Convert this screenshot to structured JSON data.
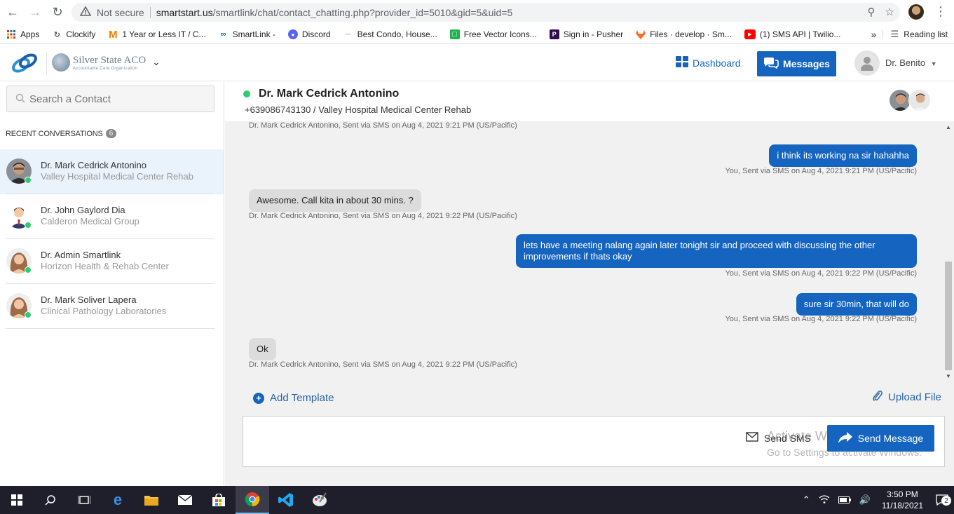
{
  "browser": {
    "security_label": "Not secure",
    "url_host": "smartstart.us",
    "url_path": "/smartlink/chat/contact_chatting.php?provider_id=5010&gid=5&uid=5",
    "bookmarks": [
      {
        "label": "Apps",
        "icon": "apps-grid-icon"
      },
      {
        "label": "Clockify",
        "icon": "clockify-icon"
      },
      {
        "label": "1 Year or Less IT / C...",
        "icon": "m-logo-icon"
      },
      {
        "label": "SmartLink -",
        "icon": "smartlink-icon"
      },
      {
        "label": "Discord",
        "icon": "discord-icon"
      },
      {
        "label": "Best Condo, House...",
        "icon": "site-icon"
      },
      {
        "label": "Free Vector Icons...",
        "icon": "flaticon-icon"
      },
      {
        "label": "Sign in - Pusher",
        "icon": "pusher-icon"
      },
      {
        "label": "Files · develop · Sm...",
        "icon": "gitlab-icon"
      },
      {
        "label": "(1) SMS API | Twilio...",
        "icon": "youtube-icon"
      }
    ],
    "bookmarks_more": "»",
    "reading_list": "Reading list"
  },
  "header": {
    "org_name": "Silver State ACO",
    "org_sub": "Accountable Care Organization",
    "dashboard_label": "Dashboard",
    "messages_label": "Messages",
    "user_name": "Dr. Benito"
  },
  "sidebar": {
    "search_placeholder": "Search a Contact",
    "recent_title": "RECENT CONVERSATIONS",
    "recent_count": "6",
    "contacts": [
      {
        "name": "Dr. Mark Cedrick Antonino",
        "org": "Valley Hospital Medical Center Rehab"
      },
      {
        "name": "Dr. John Gaylord Dia",
        "org": "Calderon Medical Group"
      },
      {
        "name": "Dr. Admin Smartlink",
        "org": "Horizon Health & Rehab Center"
      },
      {
        "name": "Dr. Mark Soliver Lapera",
        "org": "Clinical Pathology Laboratories"
      }
    ]
  },
  "chat": {
    "name": "Dr. Mark Cedrick Antonino",
    "phone": "+639086743130",
    "facility": "/ Valley Hospital Medical Center Rehab",
    "messages": [
      {
        "dir": "in",
        "text": "",
        "meta": "Dr. Mark Cedrick Antonino, Sent via SMS on Aug 4, 2021 9:21 PM (US/Pacific)"
      },
      {
        "dir": "out",
        "text": "i think its working na sir hahahha",
        "meta": "You, Sent via SMS on Aug 4, 2021 9:21 PM (US/Pacific)"
      },
      {
        "dir": "in",
        "text": "Awesome. Call kita in about 30 mins. ?",
        "meta": "Dr. Mark Cedrick Antonino, Sent via SMS on Aug 4, 2021 9:22 PM (US/Pacific)"
      },
      {
        "dir": "out",
        "text": "lets have a meeting nalang again later tonight sir and proceed with discussing the other improvements if thats okay",
        "meta": "You, Sent via SMS on Aug 4, 2021 9:22 PM (US/Pacific)"
      },
      {
        "dir": "out",
        "text": "sure sir 30min, that will do",
        "meta": "You, Sent via SMS on Aug 4, 2021 9:22 PM (US/Pacific)"
      },
      {
        "dir": "in",
        "text": "Ok",
        "meta": "Dr. Mark Cedrick Antonino, Sent via SMS on Aug 4, 2021 9:22 PM (US/Pacific)"
      }
    ],
    "add_template": "Add Template",
    "upload_file": "Upload File",
    "send_sms": "Send SMS",
    "send_message": "Send Message"
  },
  "watermark": {
    "line1": "Activate Windows",
    "line2": "Go to Settings to activate Windows."
  },
  "taskbar": {
    "time": "3:50 PM",
    "date": "11/18/2021",
    "notifications": "2"
  },
  "colors": {
    "primary": "#1565c0",
    "online": "#2ecc71",
    "incoming_bubble": "#dcdcdc",
    "chat_bg": "#f1f1f1"
  }
}
